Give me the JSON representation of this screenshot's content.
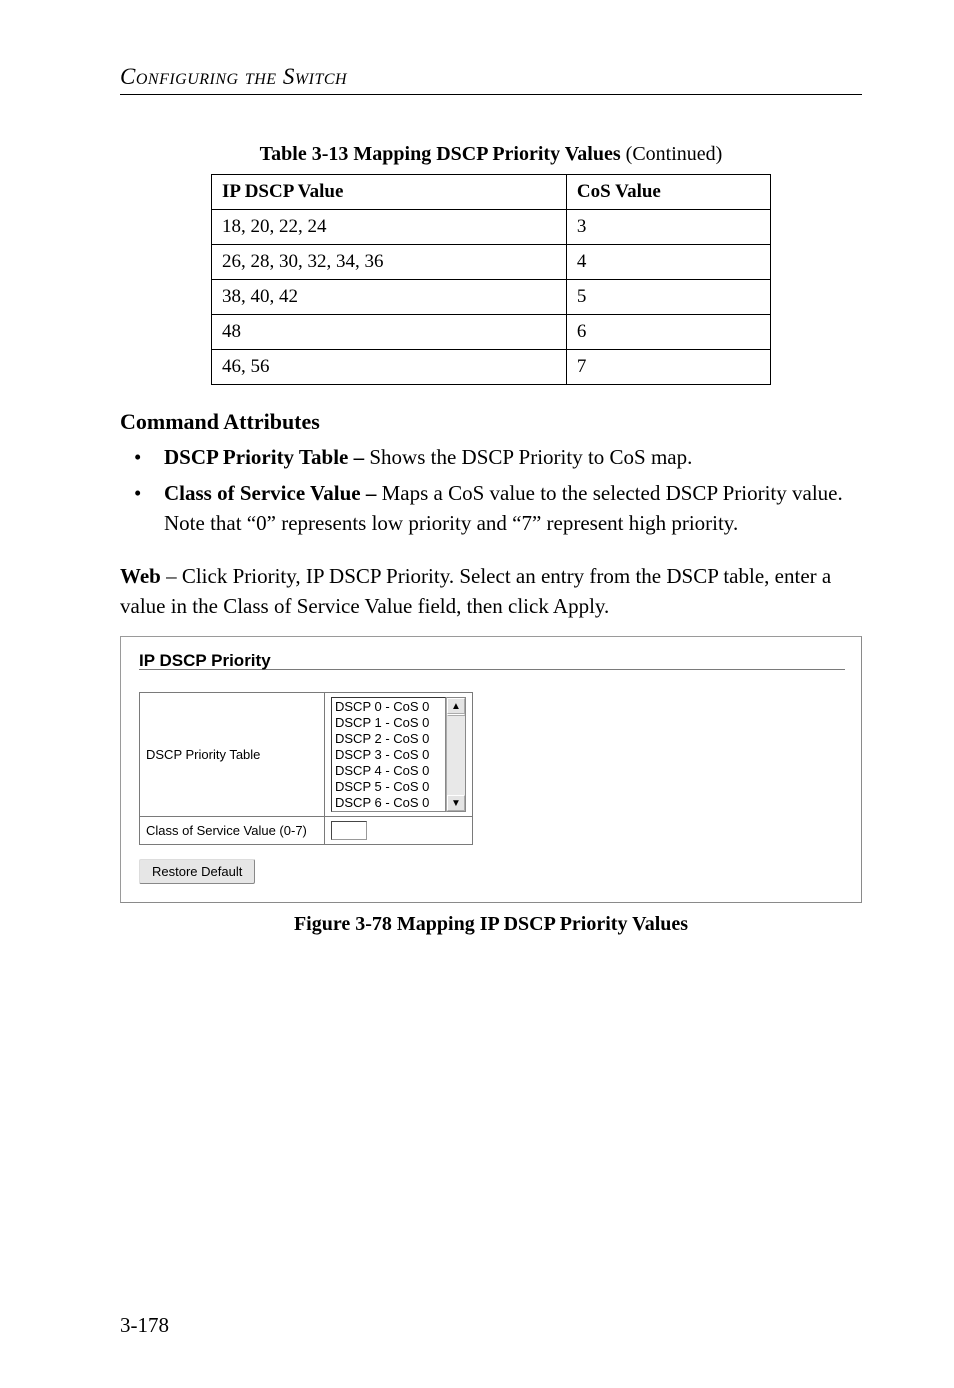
{
  "header": {
    "section_title": "Configuring the Switch"
  },
  "table_caption": {
    "lead": "Table 3-13  Mapping DSCP Priority Values",
    "tail": " (Continued)"
  },
  "mapping_table": {
    "headers": [
      "IP DSCP Value",
      "CoS Value"
    ],
    "rows": [
      {
        "dscp": "18, 20, 22, 24",
        "cos": "3"
      },
      {
        "dscp": "26, 28, 30, 32, 34, 36",
        "cos": "4"
      },
      {
        "dscp": "38, 40, 42",
        "cos": "5"
      },
      {
        "dscp": "48",
        "cos": "6"
      },
      {
        "dscp": "46, 56",
        "cos": "7"
      }
    ]
  },
  "command_attributes": {
    "heading": "Command Attributes",
    "items": [
      {
        "label": "DSCP Priority Table –",
        "text": " Shows the DSCP Priority to CoS map."
      },
      {
        "label": "Class of Service Value –",
        "text": " Maps a CoS value to the selected DSCP Priority value. Note that “0” represents low priority and “7” represent high priority."
      }
    ]
  },
  "web_paragraph": {
    "lead": "Web",
    "text": " – Click Priority, IP DSCP Priority. Select an entry from the DSCP table, enter a value in the Class of Service Value field, then click Apply."
  },
  "panel": {
    "title": "IP DSCP Priority",
    "row1_label": "DSCP Priority Table",
    "list_items": [
      "DSCP 0 - CoS 0",
      "DSCP 1 - CoS 0",
      "DSCP 2 - CoS 0",
      "DSCP 3 - CoS 0",
      "DSCP 4 - CoS 0",
      "DSCP 5 - CoS 0",
      "DSCP 6 - CoS 0"
    ],
    "row2_label": "Class of Service Value (0-7)",
    "cos_value": "",
    "restore_label": "Restore Default",
    "scroll_up_glyph": "▲",
    "scroll_down_glyph": "▼"
  },
  "figure_caption": "Figure 3-78  Mapping IP DSCP Priority Values",
  "page_number": "3-178"
}
